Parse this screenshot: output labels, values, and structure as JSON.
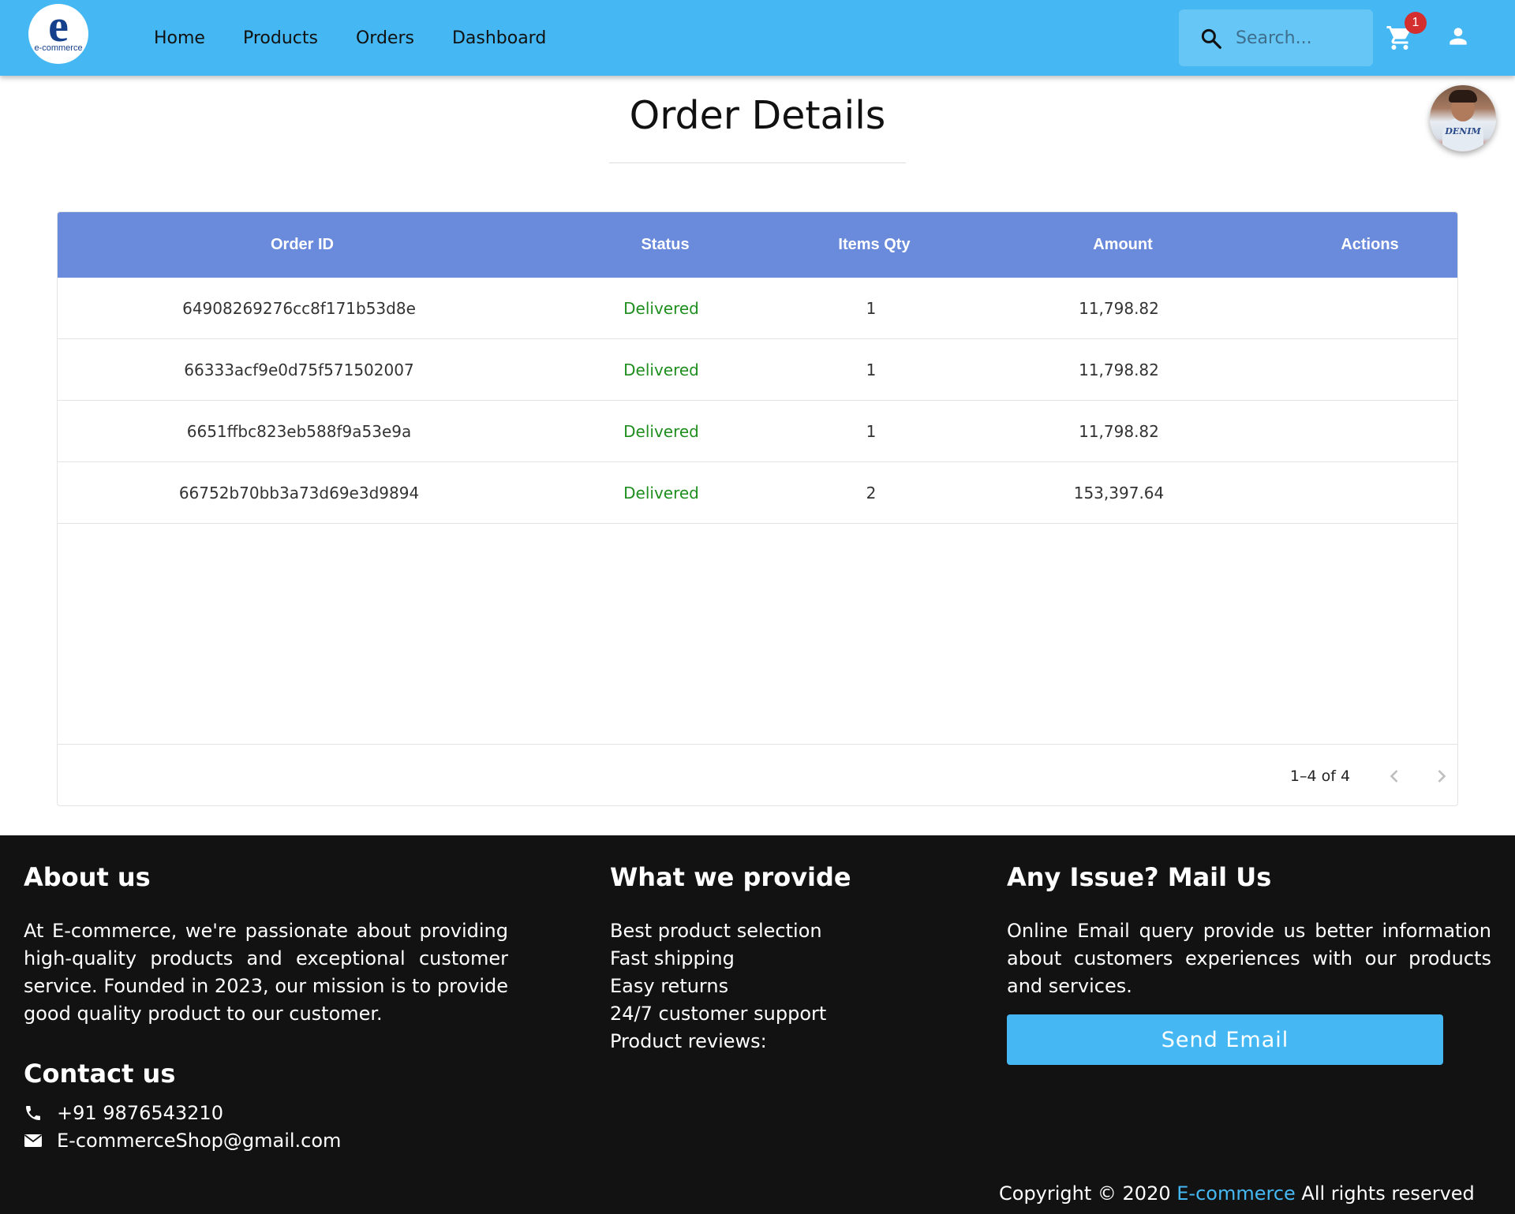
{
  "brand": {
    "logo_letter": "e",
    "logo_text": "e-commerce"
  },
  "nav": {
    "items": [
      "Home",
      "Products",
      "Orders",
      "Dashboard"
    ]
  },
  "search": {
    "placeholder": "Search..."
  },
  "cart": {
    "count": "1"
  },
  "avatar": {
    "shirt_text": "DENIM"
  },
  "page": {
    "title": "Order Details"
  },
  "table": {
    "columns": [
      "Order ID",
      "Status",
      "Items Qty",
      "Amount",
      "Actions"
    ],
    "rows": [
      {
        "order_id": "64908269276cc8f171b53d8e",
        "status": "Delivered",
        "qty": "1",
        "amount": "11,798.82"
      },
      {
        "order_id": "66333acf9e0d75f571502007",
        "status": "Delivered",
        "qty": "1",
        "amount": "11,798.82"
      },
      {
        "order_id": "6651ffbc823eb588f9a53e9a",
        "status": "Delivered",
        "qty": "1",
        "amount": "11,798.82"
      },
      {
        "order_id": "66752b70bb3a73d69e3d9894",
        "status": "Delivered",
        "qty": "2",
        "amount": "153,397.64"
      }
    ],
    "pagination": "1–4 of 4"
  },
  "footer": {
    "about": {
      "heading": "About us",
      "text": "At E-commerce, we're passionate about providing high-quality products and exceptional customer service. Founded in 2023, our mission is to provide good quality product to our customer."
    },
    "contact": {
      "heading": "Contact us",
      "phone": "+91 9876543210",
      "email": "E-commerceShop@gmail.com"
    },
    "provide": {
      "heading": "What we provide",
      "items": [
        "Best product selection",
        "Fast shipping",
        "Easy returns",
        "24/7 customer support",
        "Product reviews:"
      ]
    },
    "mail": {
      "heading": "Any Issue? Mail Us",
      "text": "Online Email query provide us better information about customers experiences with our products and services.",
      "button": "Send Email"
    },
    "copyright": {
      "prefix": "Copyright © 2020",
      "brand": "E-commerce",
      "suffix": "All rights reserved"
    }
  },
  "colors": {
    "appbar": "#45b8f4",
    "table_header": "#6a8bdb",
    "status_delivered": "#1e8e1e",
    "footer_bg": "#121212",
    "badge": "#d32f2f"
  }
}
